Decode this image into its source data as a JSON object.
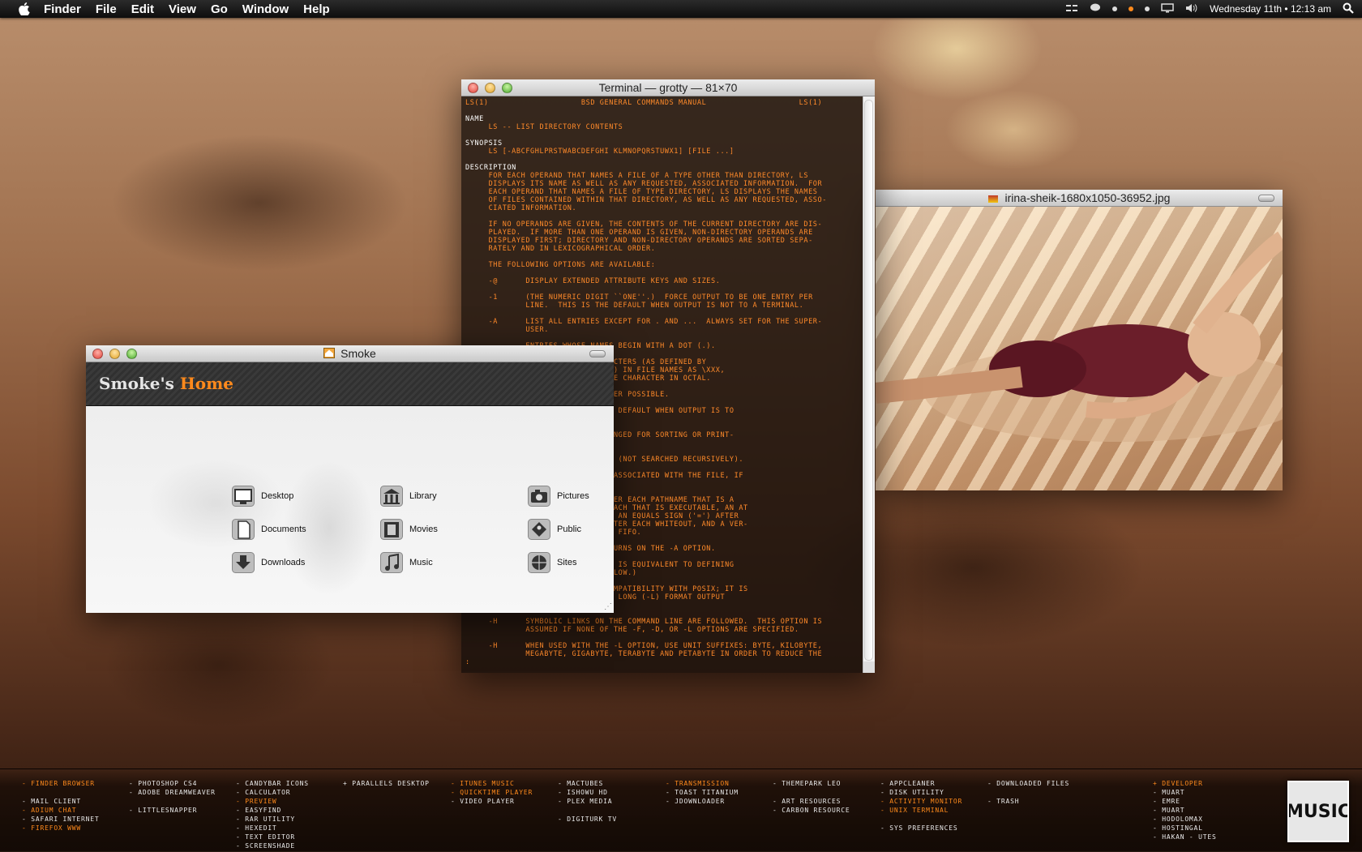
{
  "menubar": {
    "app": "Finder",
    "items": [
      "File",
      "Edit",
      "View",
      "Go",
      "Window",
      "Help"
    ],
    "datetime": "Wednesday 11th  •  12:13 am"
  },
  "terminal": {
    "title": "Terminal — grotty — 81×70",
    "lines": [
      {
        "t": "LS(1)                    BSD GENERAL COMMANDS MANUAL                    LS(1)",
        "w": false
      },
      {
        "t": "",
        "w": false
      },
      {
        "t": "NAME",
        "w": true
      },
      {
        "t": "     LS -- LIST DIRECTORY CONTENTS",
        "w": false
      },
      {
        "t": "",
        "w": false
      },
      {
        "t": "SYNOPSIS",
        "w": true
      },
      {
        "t": "     LS [-ABCFGHLPRSTWABCDEFGHI KLMNOPQRSTUWX1] [FILE ...]",
        "w": false
      },
      {
        "t": "",
        "w": false
      },
      {
        "t": "DESCRIPTION",
        "w": true
      },
      {
        "t": "     FOR EACH OPERAND THAT NAMES A FILE OF A TYPE OTHER THAN DIRECTORY, LS",
        "w": false
      },
      {
        "t": "     DISPLAYS ITS NAME AS WELL AS ANY REQUESTED, ASSOCIATED INFORMATION.  FOR",
        "w": false
      },
      {
        "t": "     EACH OPERAND THAT NAMES A FILE OF TYPE DIRECTORY, LS DISPLAYS THE NAMES",
        "w": false
      },
      {
        "t": "     OF FILES CONTAINED WITHIN THAT DIRECTORY, AS WELL AS ANY REQUESTED, ASSO-",
        "w": false
      },
      {
        "t": "     CIATED INFORMATION.",
        "w": false
      },
      {
        "t": "",
        "w": false
      },
      {
        "t": "     IF NO OPERANDS ARE GIVEN, THE CONTENTS OF THE CURRENT DIRECTORY ARE DIS-",
        "w": false
      },
      {
        "t": "     PLAYED.  IF MORE THAN ONE OPERAND IS GIVEN, NON-DIRECTORY OPERANDS ARE",
        "w": false
      },
      {
        "t": "     DISPLAYED FIRST; DIRECTORY AND NON-DIRECTORY OPERANDS ARE SORTED SEPA-",
        "w": false
      },
      {
        "t": "     RATELY AND IN LEXICOGRAPHICAL ORDER.",
        "w": false
      },
      {
        "t": "",
        "w": false
      },
      {
        "t": "     THE FOLLOWING OPTIONS ARE AVAILABLE:",
        "w": false
      },
      {
        "t": "",
        "w": false
      },
      {
        "t": "     -@      DISPLAY EXTENDED ATTRIBUTE KEYS AND SIZES.",
        "w": false
      },
      {
        "t": "",
        "w": false
      },
      {
        "t": "     -1      (THE NUMERIC DIGIT ``ONE''.)  FORCE OUTPUT TO BE ONE ENTRY PER",
        "w": false
      },
      {
        "t": "             LINE.  THIS IS THE DEFAULT WHEN OUTPUT IS NOT TO A TERMINAL.",
        "w": false
      },
      {
        "t": "",
        "w": false
      },
      {
        "t": "     -A      LIST ALL ENTRIES EXCEPT FOR . AND ...  ALWAYS SET FOR THE SUPER-",
        "w": false
      },
      {
        "t": "             USER.",
        "w": false
      },
      {
        "t": "",
        "w": false
      },
      {
        "t": "             ENTRIES WHOSE NAMES BEGIN WITH A DOT (.).",
        "w": false
      },
      {
        "t": "",
        "w": false
      },
      {
        "t": "             NON-PRINTABLE CHARACTERS (AS DEFINED BY",
        "w": false
      },
      {
        "t": "             ENT LOCALE SETTINGS) IN FILE NAMES AS \\XXX,",
        "w": false
      },
      {
        "t": "             NUMERIC VALUE OF THE CHARACTER IN OCTAL.",
        "w": false
      },
      {
        "t": "",
        "w": false
      },
      {
        "t": "             ESCAPE CODES WHENEVER POSSIBLE.",
        "w": false
      },
      {
        "t": "",
        "w": false
      },
      {
        "t": "             OUTPUT; THIS IS THE DEFAULT WHEN OUTPUT IS TO",
        "w": false
      },
      {
        "t": "",
        "w": false
      },
      {
        "t": "",
        "w": false
      },
      {
        "t": "             STATUS WAS LAST CHANGED FOR SORTING OR PRINT-",
        "w": false
      },
      {
        "t": "",
        "w": false
      },
      {
        "t": "",
        "w": false
      },
      {
        "t": "             STED AS PLAIN FILES (NOT SEARCHED RECURSIVELY).",
        "w": false
      },
      {
        "t": "",
        "w": false
      },
      {
        "t": "             CONTROL LIST (ACL) ASSOCIATED WITH THE FILE, IF",
        "w": false
      },
      {
        "t": "",
        "w": false
      },
      {
        "t": "",
        "w": false
      },
      {
        "t": "             /') IMMEDIATELY AFTER EACH PATHNAME THAT IS A",
        "w": false
      },
      {
        "t": "             ERISK ('*') AFTER EACH THAT IS EXECUTABLE, AN AT",
        "w": false
      },
      {
        "t": "             EACH SYMBOLIC LINK, AN EQUALS SIGN ('=') AFTER",
        "w": false
      },
      {
        "t": "             RCENT SIGN ('%') AFTER EACH WHITEOUT, AND A VER-",
        "w": false
      },
      {
        "t": "             FTER EACH THAT IS A FIFO.",
        "w": false
      },
      {
        "t": "",
        "w": false
      },
      {
        "t": "             TED.  THIS OPTION TURNS ON THE -A OPTION.",
        "w": false
      },
      {
        "t": "",
        "w": false
      },
      {
        "t": "             UTPUT.  THIS OPTION IS EQUIVALENT TO DEFINING",
        "w": false
      },
      {
        "t": "             VIRONMENT.  (SEE BELOW.)",
        "w": false
      },
      {
        "t": "",
        "w": false
      },
      {
        "t": "             LY AVAILABLE FOR COMPATIBILITY WITH POSIX; IT IS",
        "w": false
      },
      {
        "t": "             E GROUP NAME IN THE LONG (-L) FORMAT OUTPUT",
        "w": false
      },
      {
        "t": "             SUPPRESSED).",
        "w": false
      },
      {
        "t": "",
        "w": false
      },
      {
        "t": "     -H      SYMBOLIC LINKS ON THE COMMAND LINE ARE FOLLOWED.  THIS OPTION IS",
        "w": false
      },
      {
        "t": "             ASSUMED IF NONE OF THE -F, -D, OR -L OPTIONS ARE SPECIFIED.",
        "w": false
      },
      {
        "t": "",
        "w": false
      },
      {
        "t": "     -H      WHEN USED WITH THE -L OPTION, USE UNIT SUFFIXES: BYTE, KILOBYTE,",
        "w": false
      },
      {
        "t": "             MEGABYTE, GIGABYTE, TERABYTE AND PETABYTE IN ORDER TO REDUCE THE",
        "w": false
      },
      {
        "t": ":",
        "w": false
      }
    ]
  },
  "image_window": {
    "title": "irina-sheik-1680x1050-36952.jpg"
  },
  "smoke": {
    "title": "Smoke",
    "logo_part1": "Smoke's",
    "logo_part2": "Home",
    "items": [
      {
        "label": "Desktop",
        "icon": "desktop-icon"
      },
      {
        "label": "Library",
        "icon": "library-icon"
      },
      {
        "label": "Pictures",
        "icon": "pictures-icon"
      },
      {
        "label": "Documents",
        "icon": "documents-icon"
      },
      {
        "label": "Movies",
        "icon": "movies-icon"
      },
      {
        "label": "Public",
        "icon": "public-icon"
      },
      {
        "label": "Downloads",
        "icon": "downloads-icon"
      },
      {
        "label": "Music",
        "icon": "music-icon"
      },
      {
        "label": "Sites",
        "icon": "sites-icon"
      }
    ]
  },
  "dock": {
    "columns": [
      [
        {
          "t": "- FINDER BROWSER",
          "o": true
        },
        {
          "t": "",
          "o": false
        },
        {
          "t": "- MAIL CLIENT",
          "o": false
        },
        {
          "t": "- ADIUM CHAT",
          "o": true
        },
        {
          "t": "- SAFARI INTERNET",
          "o": false
        },
        {
          "t": "- FIREFOX WWW",
          "o": true
        }
      ],
      [
        {
          "t": "- PHOTOSHOP CS4",
          "o": false
        },
        {
          "t": "- ADOBE DREAMWEAVER",
          "o": false
        },
        {
          "t": "",
          "o": false
        },
        {
          "t": "- LITTLESNAPPER",
          "o": false
        }
      ],
      [
        {
          "t": "- CANDYBAR ICONS",
          "o": false
        },
        {
          "t": "- CALCULATOR",
          "o": false
        },
        {
          "t": "- PREVIEW",
          "o": true
        },
        {
          "t": "- EASYFIND",
          "o": false
        },
        {
          "t": "- RAR UTILITY",
          "o": false
        },
        {
          "t": "- HEXEDIT",
          "o": false
        },
        {
          "t": "- TEXT EDITOR",
          "o": false
        },
        {
          "t": "- SCREENSHADE",
          "o": false
        }
      ],
      [
        {
          "t": "+ PARALLELS DESKTOP",
          "o": false
        }
      ],
      [
        {
          "t": "- ITUNES MUSIC",
          "o": true
        },
        {
          "t": "- QUICKTIME PLAYER",
          "o": true
        },
        {
          "t": "- VIDEO PLAYER",
          "o": false
        }
      ],
      [
        {
          "t": "- MACTUBES",
          "o": false
        },
        {
          "t": "- ISHOWU HD",
          "o": false
        },
        {
          "t": "- PLEX MEDIA",
          "o": false
        },
        {
          "t": "",
          "o": false
        },
        {
          "t": "- DIGITURK TV",
          "o": false
        }
      ],
      [
        {
          "t": "- TRANSMISSION",
          "o": true
        },
        {
          "t": "- TOAST TITANIUM",
          "o": false
        },
        {
          "t": "- JDOWNLOADER",
          "o": false
        }
      ],
      [
        {
          "t": "- THEMEPARK LEO",
          "o": false
        },
        {
          "t": "",
          "o": false
        },
        {
          "t": "- ART RESOURCES",
          "o": false
        },
        {
          "t": "- CARBON RESOURCE",
          "o": false
        }
      ],
      [
        {
          "t": "- APPCLEANER",
          "o": false
        },
        {
          "t": "- DISK UTILITY",
          "o": false
        },
        {
          "t": "- ACTIVITY MONITOR",
          "o": true
        },
        {
          "t": "- UNIX TERMINAL",
          "o": true
        },
        {
          "t": "",
          "o": false
        },
        {
          "t": "- SYS PREFERENCES",
          "o": false
        }
      ],
      [
        {
          "t": "- DOWNLOADED FILES",
          "o": false
        },
        {
          "t": "",
          "o": false
        },
        {
          "t": "- TRASH",
          "o": false
        }
      ],
      [
        {
          "t": "+ DEVELOPER",
          "o": true
        },
        {
          "t": "- MUART",
          "o": false
        },
        {
          "t": "- EMRE",
          "o": false
        },
        {
          "t": "- MUART",
          "o": false
        },
        {
          "t": "- HODOLOMAX",
          "o": false
        },
        {
          "t": "- HOSTINGAL",
          "o": false
        },
        {
          "t": "- HAKAN - UTES",
          "o": false
        }
      ]
    ],
    "music_tile": "MUSIC"
  }
}
